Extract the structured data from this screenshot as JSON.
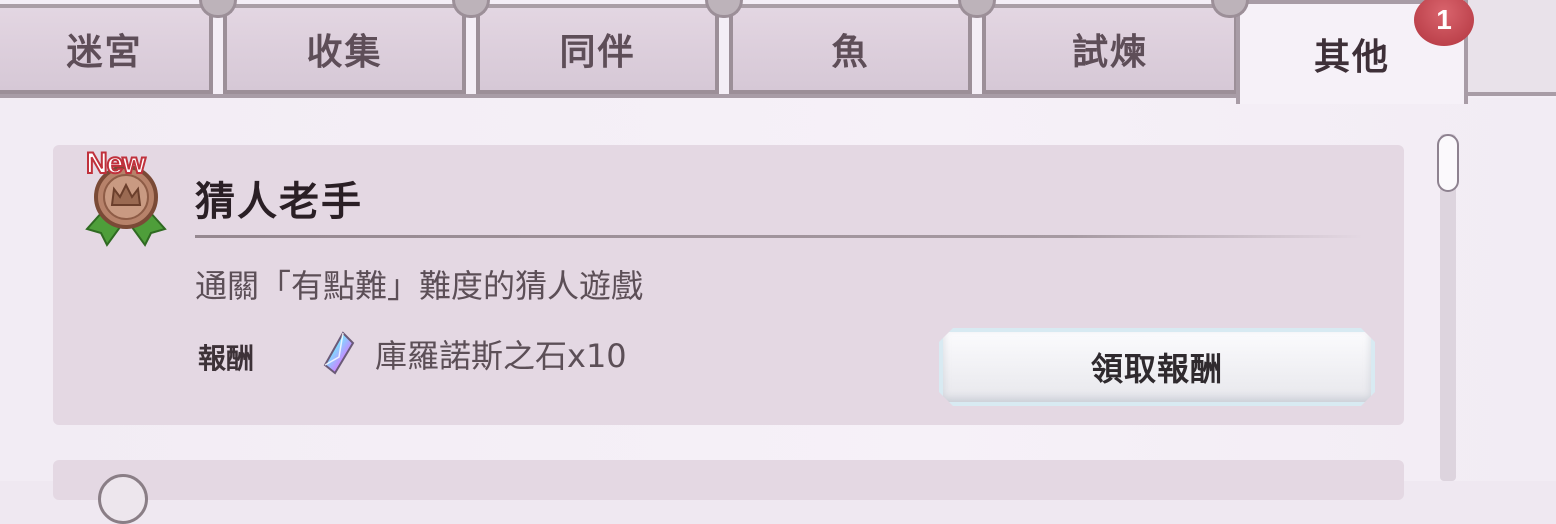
{
  "tabs": [
    {
      "label": "迷宮"
    },
    {
      "label": "收集"
    },
    {
      "label": "同伴"
    },
    {
      "label": "魚"
    },
    {
      "label": "試煉"
    },
    {
      "label": "其他"
    }
  ],
  "active_tab": "其他",
  "notification_badge": "1",
  "achievement": {
    "new_label": "New",
    "title": "猜人老手",
    "description": "通關「有點難」難度的猜人遊戲",
    "reward_label": "報酬",
    "reward_value": "庫羅諾斯之石x10",
    "claim_button": "領取報酬"
  },
  "colors": {
    "tab_bg": "#dccfdb",
    "active_tab_bg": "#f6f1f8",
    "card_bg": "#e4d8e3",
    "badge": "#c0414b"
  }
}
